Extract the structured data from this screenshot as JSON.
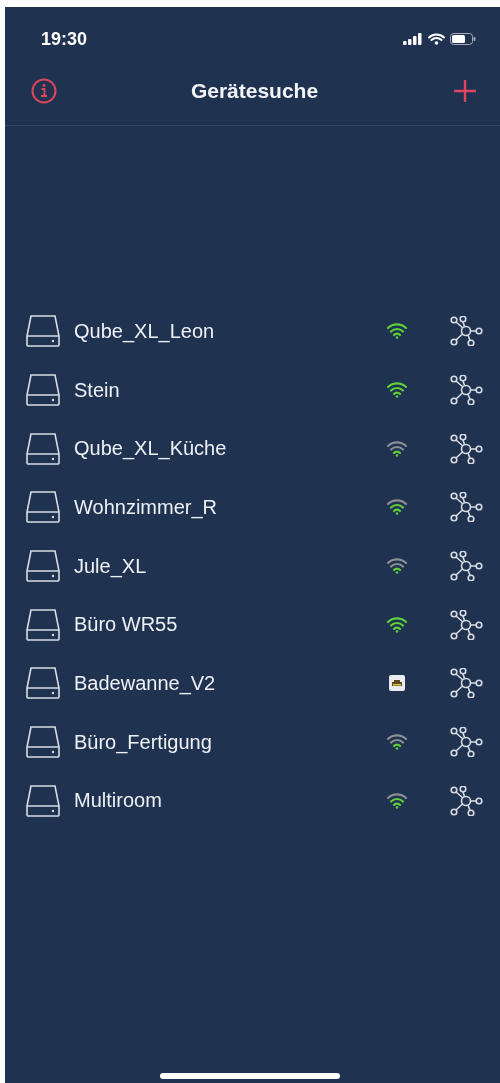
{
  "status_bar": {
    "time": "19:30"
  },
  "header": {
    "title": "Gerätesuche"
  },
  "devices": [
    {
      "name": "Qube_XL_Leon",
      "kind": "wifi3"
    },
    {
      "name": "Stein",
      "kind": "wifi3"
    },
    {
      "name": "Qube_XL_Küche",
      "kind": "wifi1"
    },
    {
      "name": "Wohnzimmer_R",
      "kind": "wifi2"
    },
    {
      "name": "Jule_XL",
      "kind": "wifi1"
    },
    {
      "name": "Büro WR55",
      "kind": "wifi3"
    },
    {
      "name": "Badewanne_V2",
      "kind": "ethernet"
    },
    {
      "name": "Büro_Fertigung",
      "kind": "wifi1"
    },
    {
      "name": "Multiroom",
      "kind": "wifi2"
    }
  ]
}
